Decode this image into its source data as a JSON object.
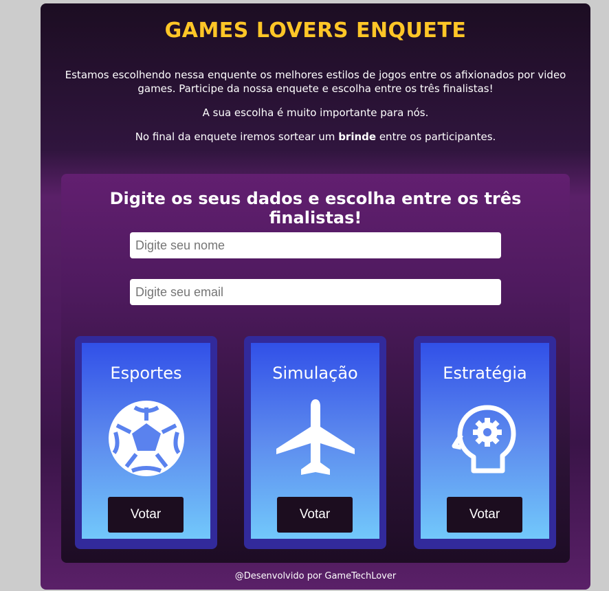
{
  "header": {
    "title": "GAMES LOVERS ENQUETE"
  },
  "intro": {
    "paragraph1": "Estamos escolhendo nessa enquente os melhores estilos de jogos entre os afixionados por video games. Participe da nossa enquete e escolha entre os três finalistas!",
    "paragraph2": "A sua escolha é muito importante para nós.",
    "paragraph3_before": "No final da enquete iremos sortear um ",
    "paragraph3_bold": "brinde",
    "paragraph3_after": " entre os participantes."
  },
  "form": {
    "title": "Digite os seus dados e escolha entre os três finalistas!",
    "name_placeholder": "Digite seu nome",
    "email_placeholder": "Digite seu email",
    "name_value": "",
    "email_value": ""
  },
  "options": [
    {
      "label": "Esportes",
      "icon": "soccer-ball-icon",
      "button": "Votar"
    },
    {
      "label": "Simulação",
      "icon": "airplane-icon",
      "button": "Votar"
    },
    {
      "label": "Estratégia",
      "icon": "head-gear-icon",
      "button": "Votar"
    }
  ],
  "footer": {
    "text": "@Desenvolvido por GameTechLover"
  },
  "colors": {
    "title": "#ffc627",
    "option_border": "#322a9b",
    "vote_button": "#1c0d1f",
    "page_background": "#cccccc"
  }
}
